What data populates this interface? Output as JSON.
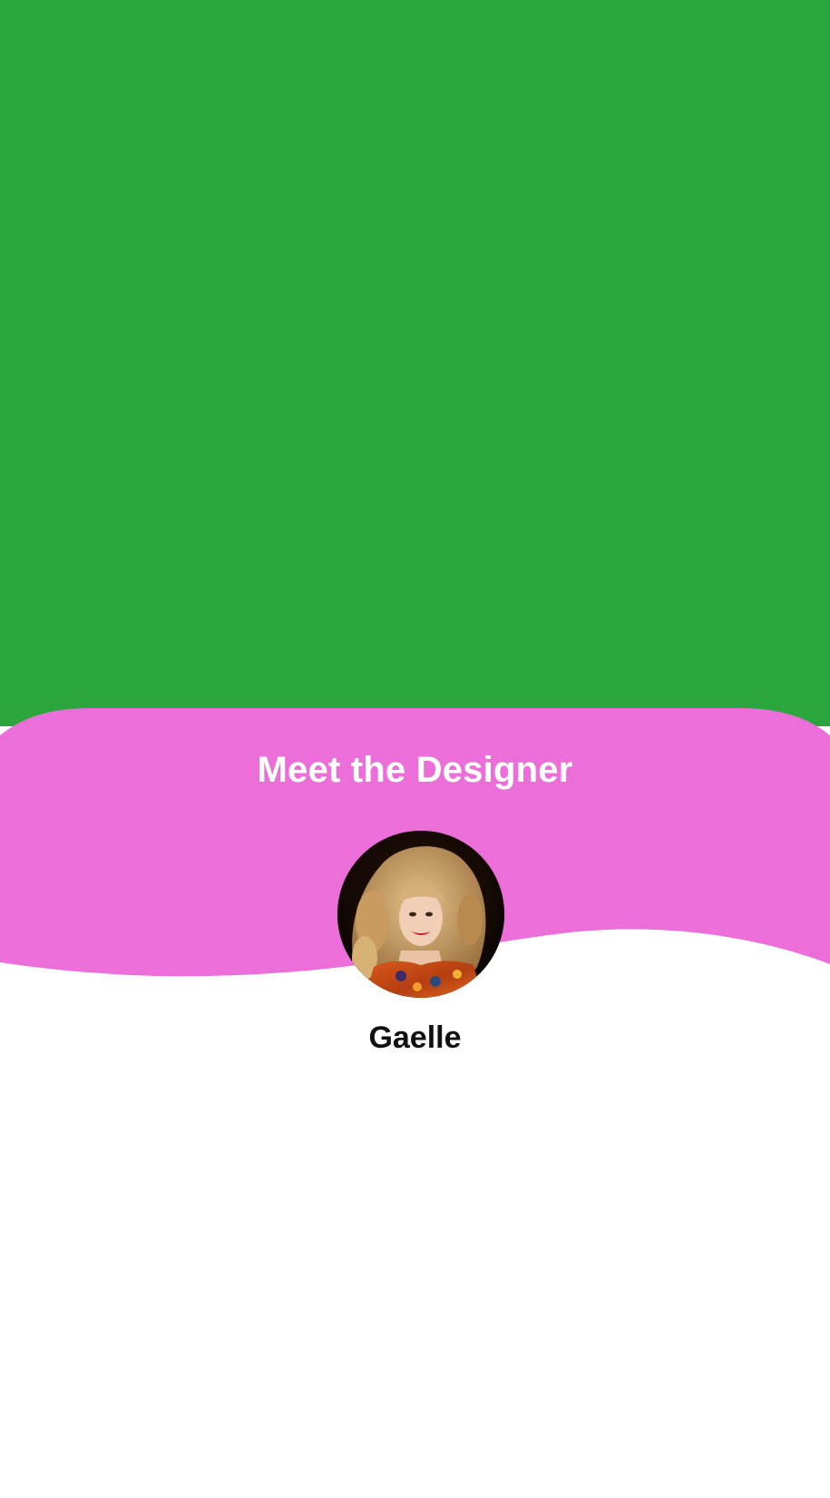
{
  "section": {
    "title": "Meet the Designer"
  },
  "designer": {
    "name": "Gaelle"
  },
  "colors": {
    "hero_background": "#2aa63c",
    "card_background": "#ec6fd9",
    "page_background": "#ffffff"
  },
  "icons": {
    "avatar": "designer-portrait"
  }
}
